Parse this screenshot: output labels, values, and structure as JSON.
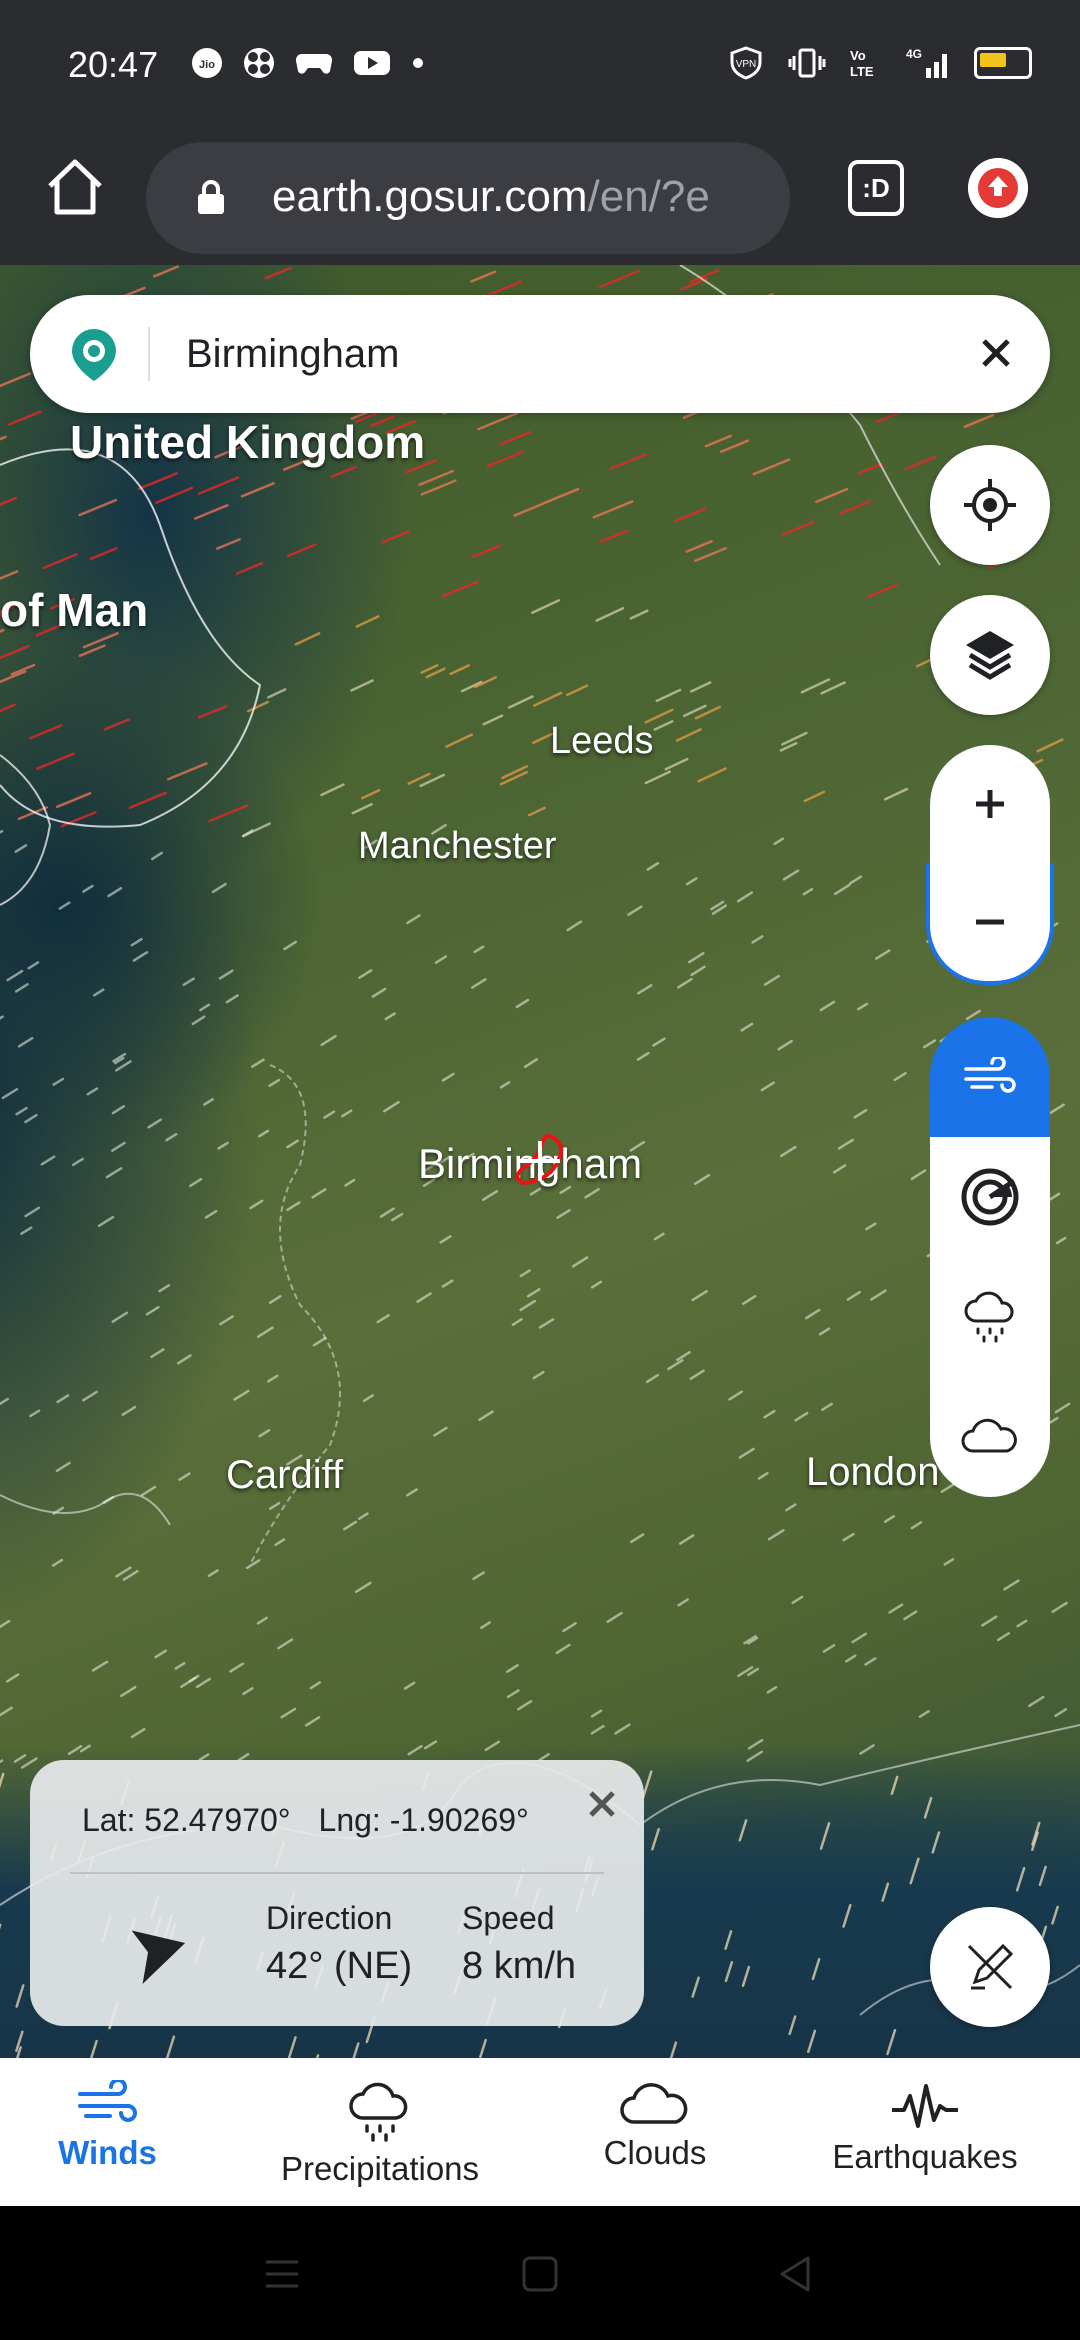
{
  "status_bar": {
    "time": "20:47",
    "left_icons": [
      "jio-icon",
      "fan-icon",
      "gamepad-icon",
      "youtube-icon",
      "dot-icon"
    ],
    "right_icons": [
      "vpn-icon",
      "vibrate-icon",
      "volte-icon",
      "signal-4g-icon",
      "battery-icon"
    ],
    "vpn_label": "VPN",
    "network_label": "4G"
  },
  "browser": {
    "url_host": "earth.gosur.com",
    "url_path": "/en/?e",
    "tab_label": ":D",
    "home_icon": "home-icon",
    "update_icon": "update-icon"
  },
  "search": {
    "value": "Birmingham",
    "logo_icon": "map-pin-logo-icon",
    "clear_icon": "close-icon"
  },
  "map": {
    "labels": {
      "united_kingdom": "United Kingdom",
      "isle_of_man": "of Man",
      "leeds": "Leeds",
      "manchester": "Manchester",
      "birmingham": "Birmingham",
      "cardiff": "Cardiff",
      "london": "London"
    }
  },
  "controls": {
    "locate": "locate-icon",
    "layers": "layers-icon",
    "zoom_in": "plus-icon",
    "zoom_out": "minus-icon",
    "layer_buttons": [
      "wind-icon",
      "radar-icon",
      "rain-cloud-icon",
      "cloud-icon"
    ],
    "active_layer": "wind-icon",
    "draw": "draw-off-icon"
  },
  "info_card": {
    "lat": "Lat: 52.47970°",
    "lng": "Lng: -1.90269°",
    "direction_label": "Direction",
    "direction_value": "42° (NE)",
    "speed_label": "Speed",
    "speed_value": "8 km/h"
  },
  "bottom_nav": {
    "items": [
      {
        "label": "Winds",
        "icon": "wind-icon",
        "active": true
      },
      {
        "label": "Precipitations",
        "icon": "rain-cloud-icon",
        "active": false
      },
      {
        "label": "Clouds",
        "icon": "cloud-icon",
        "active": false
      },
      {
        "label": "Earthquakes",
        "icon": "seismograph-icon",
        "active": false
      }
    ]
  },
  "colors": {
    "accent": "#1a73e8",
    "chrome": "#2b2c30",
    "battery": "#f2c31a",
    "logo": "#1a9e8f"
  }
}
